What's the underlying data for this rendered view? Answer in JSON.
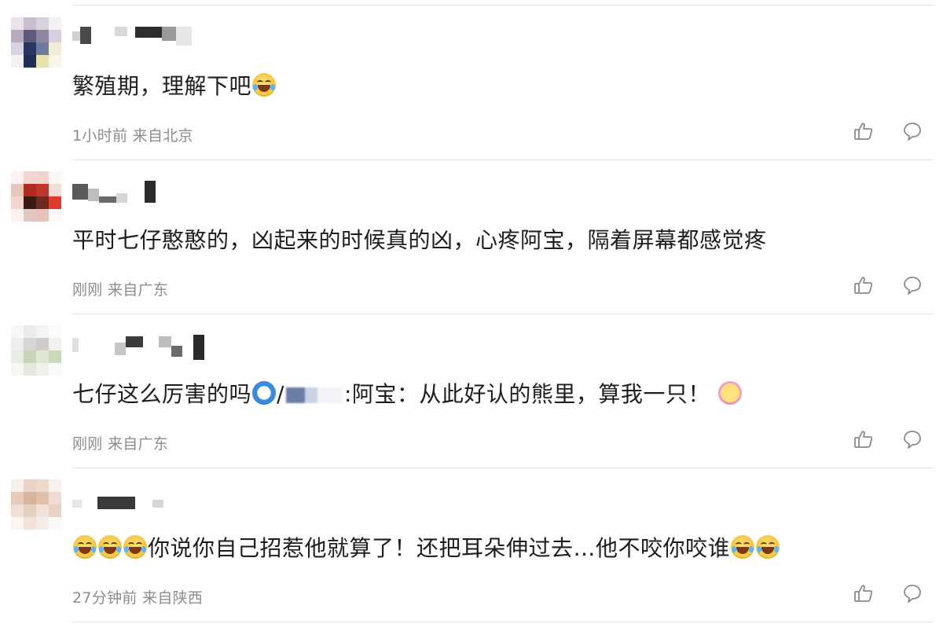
{
  "comments": [
    {
      "text_before": "繁殖期，理解下吧",
      "emoji_after": "laughing-crying-emoji",
      "time": "1小时前",
      "location": "来自北京"
    },
    {
      "text_before": "平时七仔憨憨的，凶起来的时候真的凶，心疼阿宝，隔着屏幕都感觉疼",
      "time": "刚刚",
      "location": "来自广东"
    },
    {
      "text_before": "七仔这么厉害的吗",
      "emoji_mid": "doraemon-emoji",
      "slash": "/",
      "text_after": ":阿宝：从此好认的熊里，算我一只！",
      "emoji_after": "flower-face-emoji",
      "time": "刚刚",
      "location": "来自广东"
    },
    {
      "emoji_before": "laughing-emoji",
      "text_before": "你说你自己招惹他就算了！还把耳朵伸过去…他不咬你咬谁",
      "emoji_after": "laughing-emoji",
      "time": "27分钟前",
      "location": "来自陕西"
    }
  ],
  "icons": {
    "like": "thumbs-up-icon",
    "comment": "comment-bubble-icon"
  },
  "colors": {
    "text": "#1e1e1e",
    "meta": "#8d8d8d",
    "divider": "#e3e3e3",
    "icon": "#8a8a8a"
  }
}
